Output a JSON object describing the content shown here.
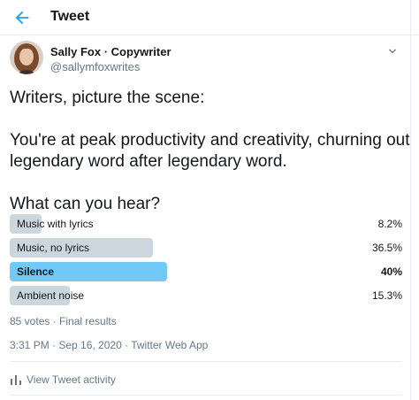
{
  "header": {
    "title": "Tweet",
    "back_icon": "arrow-left-icon",
    "accent": "#1da1f2"
  },
  "tweet": {
    "author_name": "Sally Fox · Copywriter",
    "author_handle": "@sallymfoxwrites",
    "menu_icon": "chevron-down-icon",
    "text_lines": [
      "Writers, picture the scene:",
      "",
      "You're at peak productivity and creativity, churning out",
      "legendary word after legendary word.",
      "",
      "What can you hear?"
    ]
  },
  "poll": {
    "options": [
      {
        "label": "Music with lyrics",
        "percent_text": "8.2%",
        "percent": 8.2,
        "winner": false
      },
      {
        "label": "Music, no lyrics",
        "percent_text": "36.5%",
        "percent": 36.5,
        "winner": false
      },
      {
        "label": "Silence",
        "percent_text": "40%",
        "percent": 40,
        "winner": true
      },
      {
        "label": "Ambient noise",
        "percent_text": "15.3%",
        "percent": 15.3,
        "winner": false
      }
    ],
    "meta": "85 votes · Final results",
    "bar_color": "#ccd6dd",
    "winner_color": "#71c9f8"
  },
  "timestamp": "3:31 PM · Sep 16, 2020 · Twitter Web App",
  "activity": {
    "label": "View Tweet activity",
    "icon": "bar-chart-icon"
  }
}
